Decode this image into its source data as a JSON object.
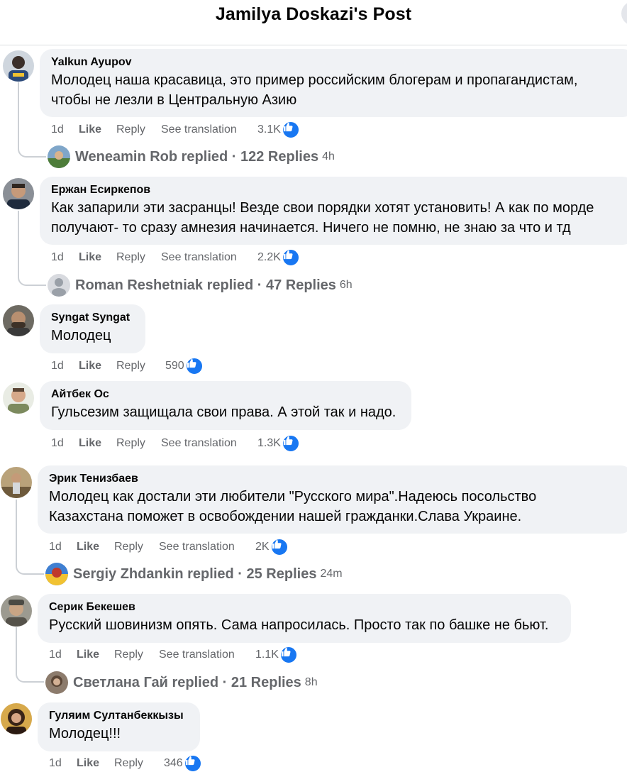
{
  "header": {
    "title": "Jamilya Doskazi's Post"
  },
  "comments": [
    {
      "author": "Yalkun Ayupov",
      "lines": [
        "Молодец наша красавица, это пример российским блогерам и пропагандистам,",
        "чтобы не лезли в Центральную Азию"
      ],
      "time": "1d",
      "like": "Like",
      "reply": "Reply",
      "translate": "See translation",
      "reactions": "3.1K",
      "replies": {
        "text": "Weneamin Rob replied · 122 Replies",
        "time": "4h"
      }
    },
    {
      "author": "Ержан Есиркепов",
      "lines": [
        "Как запарили эти засранцы! Везде свои порядки хотят установить! А как по морде",
        "получают- то сразу амнезия начинается. Ничего не помню, не знаю за что и тд"
      ],
      "time": "1d",
      "like": "Like",
      "reply": "Reply",
      "translate": "See translation",
      "reactions": "2.2K",
      "replies": {
        "text": "Roman Reshetniak replied · 47 Replies",
        "time": "6h"
      }
    },
    {
      "author": "Syngat Syngat",
      "lines": [
        "Молодец"
      ],
      "time": "1d",
      "like": "Like",
      "reply": "Reply",
      "reactions": "590"
    },
    {
      "author": "Айтбек Ос",
      "lines": [
        "Гульсезим защищала свои права. А этой так и надо."
      ],
      "time": "1d",
      "like": "Like",
      "reply": "Reply",
      "translate": "See translation",
      "reactions": "1.3K"
    },
    {
      "author": "Эрик Тенизбаев",
      "lines": [
        "Молодец как достали эти любители \"Русского мира\".Надеюсь посольство",
        "Казахстана поможет в освобождении нашей гражданки.Слава Украине."
      ],
      "time": "1d",
      "like": "Like",
      "reply": "Reply",
      "translate": "See translation",
      "reactions": "2K",
      "replies": {
        "text": "Sergiy Zhdankin replied · 25 Replies",
        "time": "24m"
      }
    },
    {
      "author": "Серик Бекешев",
      "lines": [
        "Русский шовинизм опять. Сама напросилась. Просто так по башке не бьют."
      ],
      "time": "1d",
      "like": "Like",
      "reply": "Reply",
      "translate": "See translation",
      "reactions": "1.1K",
      "replies": {
        "text": "Светлана Гай replied · 21 Replies",
        "time": "8h"
      }
    },
    {
      "author": "Гуляим Султанбеккызы",
      "lines": [
        "Молодец!!!"
      ],
      "time": "1d",
      "like": "Like",
      "reply": "Reply",
      "reactions": "346"
    }
  ],
  "colors": {
    "like_blue": "#1877f2",
    "bubble_bg": "#f0f2f5",
    "meta_gray": "#65676b"
  }
}
